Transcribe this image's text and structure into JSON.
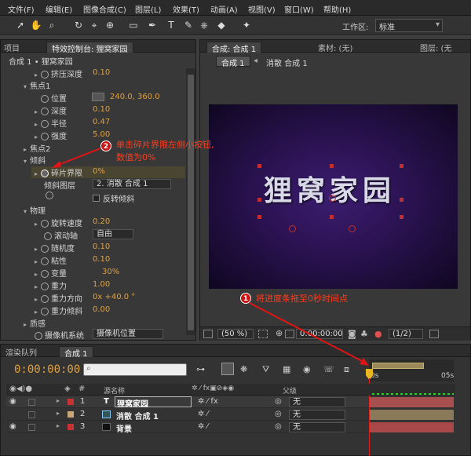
{
  "menu": [
    "文件(F)",
    "编辑(E)",
    "图像合成(C)",
    "图层(L)",
    "效果(T)",
    "动画(A)",
    "视图(V)",
    "窗口(W)",
    "帮助(H)"
  ],
  "workspace": {
    "label": "工作区:",
    "value": "标准"
  },
  "left_panel": {
    "tab_project": "项目",
    "tab_effects": "特效控制台: 狸窝家园",
    "breadcrumb": "合成 1 • 狸窝家园",
    "rows": [
      {
        "label": "挤压深度",
        "value": "0.10"
      },
      {
        "label": "焦点1",
        "value": ""
      },
      {
        "label": "位置",
        "value": "240.0, 360.0"
      },
      {
        "label": "深度",
        "value": "0.10"
      },
      {
        "label": "半径",
        "value": "0.47"
      },
      {
        "label": "强度",
        "value": "5.00"
      },
      {
        "label": "焦点2",
        "value": ""
      },
      {
        "label": "倾斜",
        "value": ""
      },
      {
        "label": "碎片界限",
        "value": "0%"
      },
      {
        "label": "倾斜图层",
        "value": "2. 消散 合成 1"
      },
      {
        "label": "反转倾斜",
        "value": ""
      },
      {
        "label": "物理",
        "value": ""
      },
      {
        "label": "旋转速度",
        "value": "0.20"
      },
      {
        "label": "滚动轴",
        "value": "自由"
      },
      {
        "label": "随机度",
        "value": "0.10"
      },
      {
        "label": "粘性",
        "value": "0.10"
      },
      {
        "label": "变量",
        "value": "30%"
      },
      {
        "label": "重力",
        "value": "1.00"
      },
      {
        "label": "重力方向",
        "value": "0x +40.0 °"
      },
      {
        "label": "重力倾斜",
        "value": "0.00"
      },
      {
        "label": "质感",
        "value": ""
      },
      {
        "label": "摄像机系统",
        "value": "摄像机位置"
      }
    ]
  },
  "comp_panel": {
    "tab": "合成: 合成 1",
    "tab_footage": "素材: (无)",
    "tab_layer": "图层: (无",
    "crumb_active": "合成 1",
    "crumb_next": "消散 合成 1",
    "zoom": "(50 %)",
    "time": "0:00:00:00",
    "res": "(1/2)",
    "overlay_text": "狸窝家园"
  },
  "annotations": {
    "one": "1",
    "one_text": "将进度条拖至0秒时间点",
    "two": "2",
    "two_text_line1": "单击碎片界限左侧小按钮,",
    "two_text_line2": "数值为0%"
  },
  "timeline": {
    "tab_render": "渲染队列",
    "tab_comp": "合成 1",
    "current_time": "0:00:00:00",
    "col_name": "源名称",
    "col_parent": "父级",
    "ruler_start": "0s",
    "ruler_end": "05s",
    "layers": [
      {
        "num": "1",
        "type": "T",
        "name": "狸窝家园",
        "parent": "无",
        "color": "#c83232"
      },
      {
        "num": "2",
        "type": "comp",
        "name": "消散 合成 1",
        "parent": "无",
        "color": "#c8a878"
      },
      {
        "num": "3",
        "type": "solid",
        "name": "背景",
        "parent": "无",
        "color": "#c83232"
      }
    ]
  }
}
